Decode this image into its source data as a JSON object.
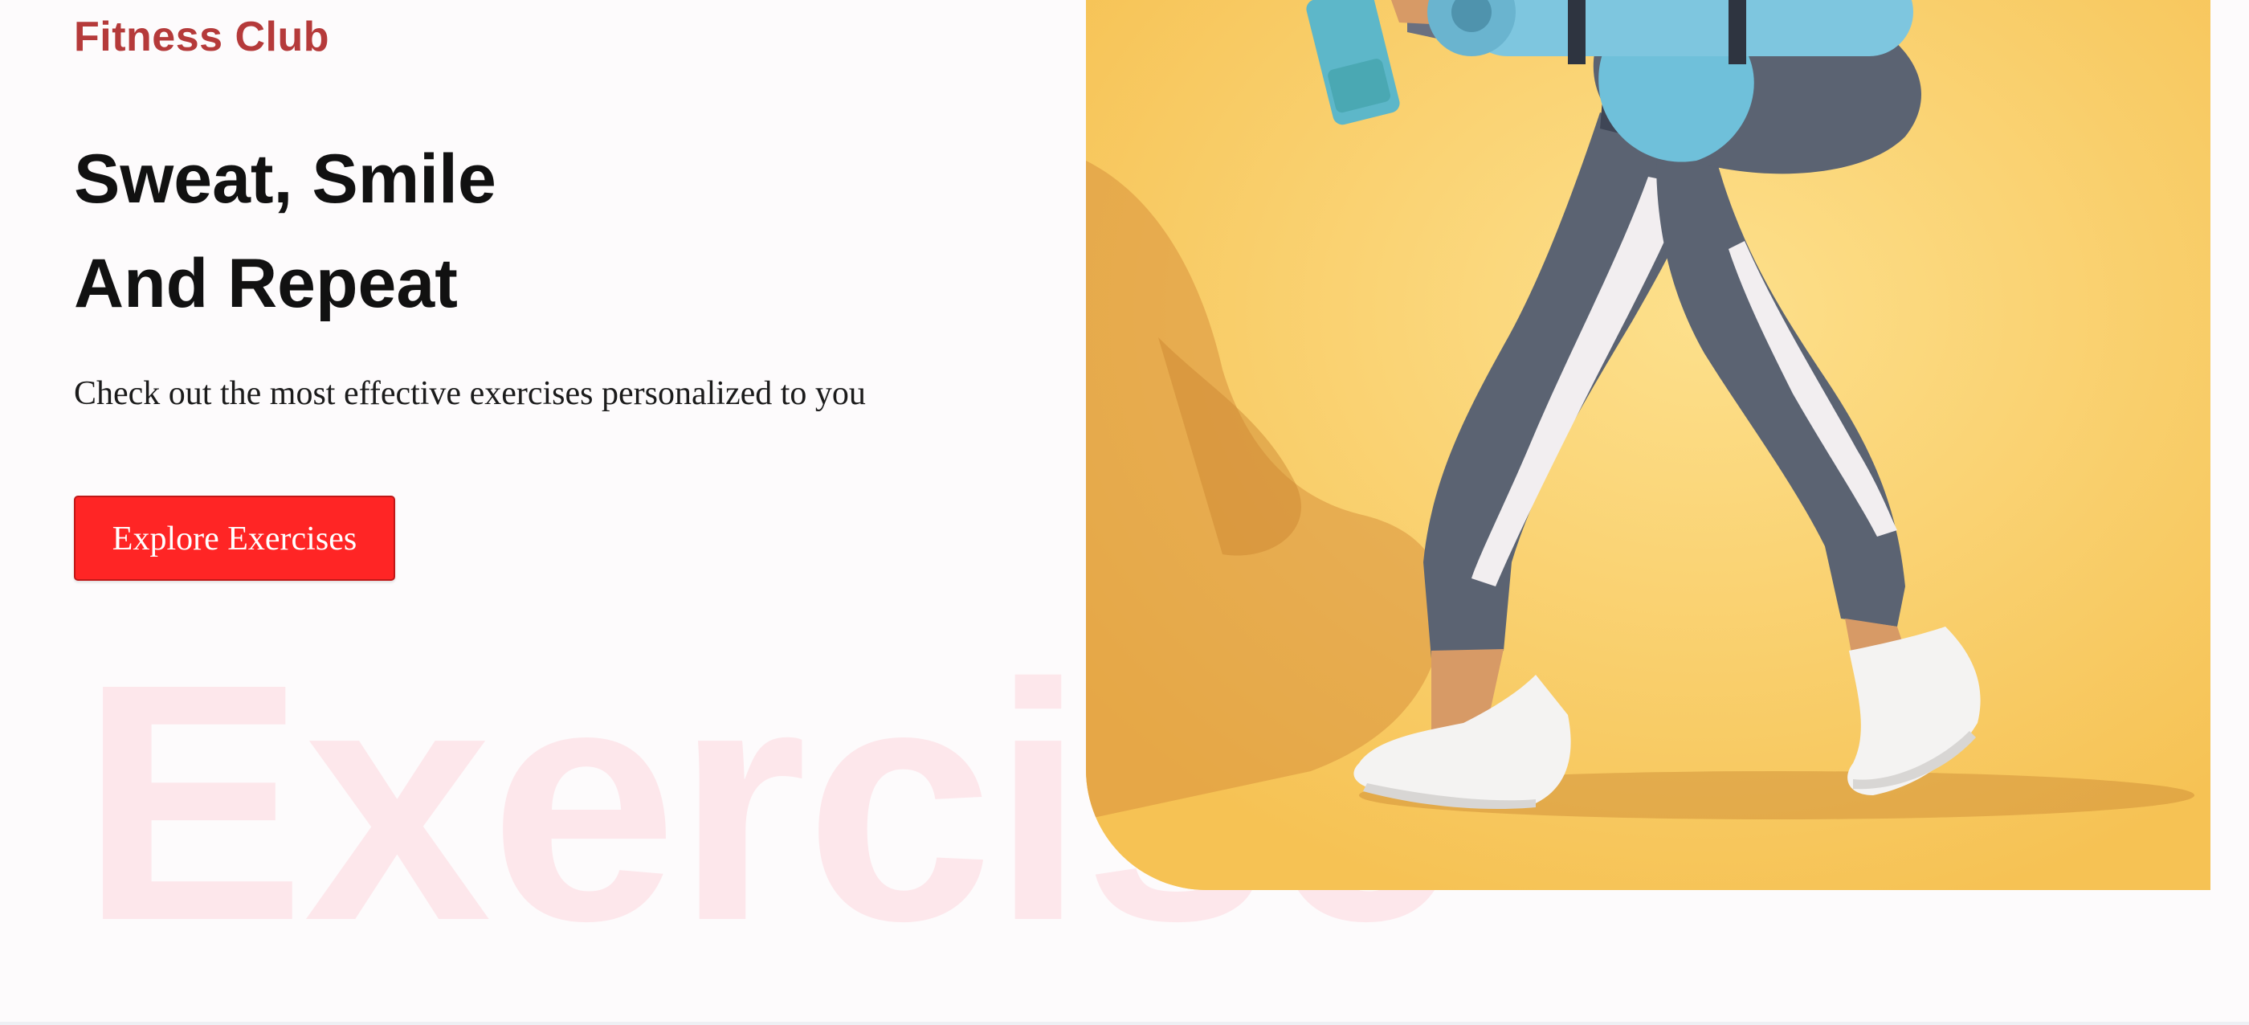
{
  "brand": {
    "name": "Fitness Club"
  },
  "hero": {
    "headline_line1": "Sweat, Smile",
    "headline_line2": "And Repeat",
    "subtitle": "Check out the most effective exercises personalized to you",
    "cta_label": "Explore Exercises",
    "watermark": "Exercise",
    "image_alt": "Woman walking with water bottle, gym bag and yoga mat"
  },
  "colors": {
    "brand": "#b53a3a",
    "accent": "#ff2525",
    "photo_background": "#f9cf68",
    "watermark": "#ff2f4d"
  }
}
